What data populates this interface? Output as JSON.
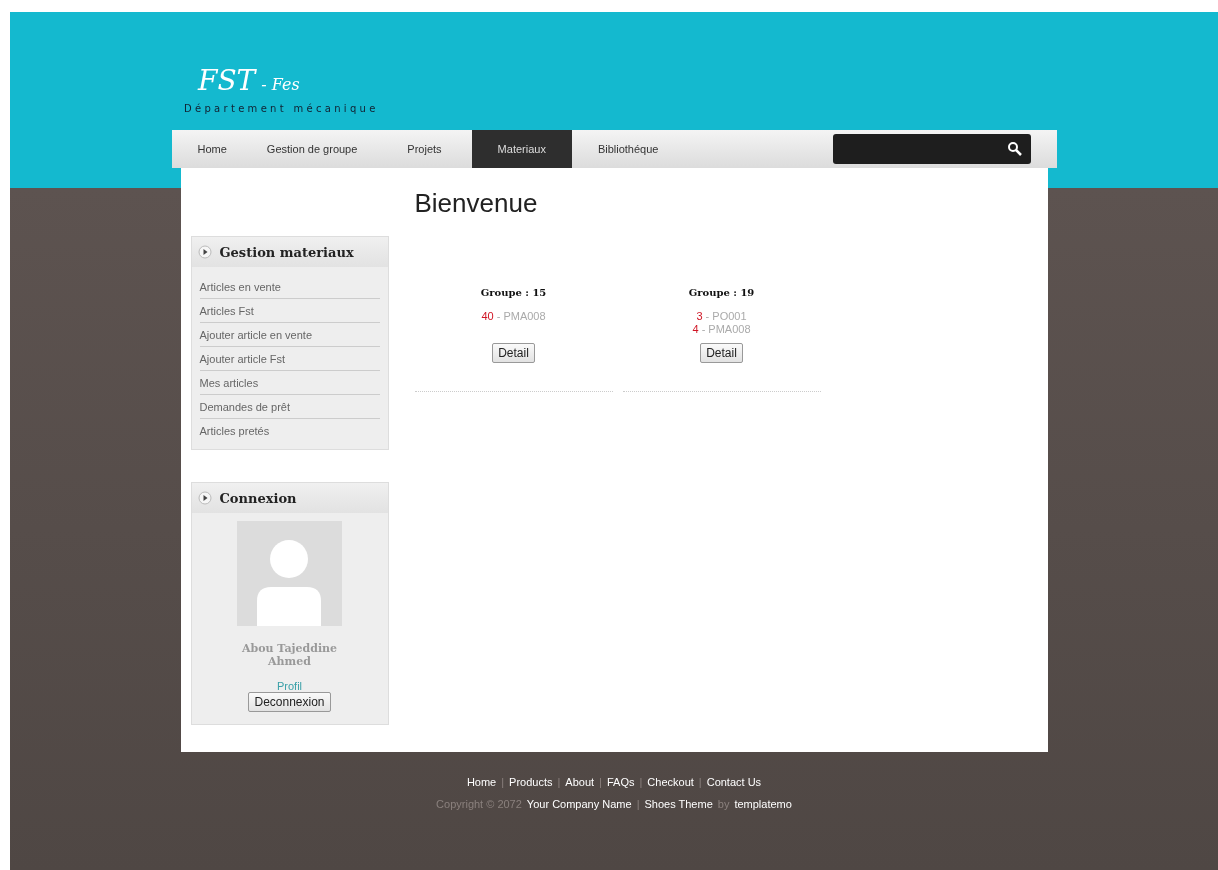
{
  "header": {
    "logo": "FST",
    "logo_suffix": "- Fes",
    "subtitle": "Département mécanique"
  },
  "nav": [
    {
      "label": "Home",
      "selected": false
    },
    {
      "label": "Gestion de groupe",
      "selected": false
    },
    {
      "label": "Projets",
      "selected": false
    },
    {
      "label": "Materiaux",
      "selected": true
    },
    {
      "label": "Bibliothéque",
      "selected": false
    }
  ],
  "sidebar": {
    "menu": {
      "title": "Gestion materiaux",
      "items": [
        "Articles en vente",
        "Articles Fst",
        "Ajouter article en vente",
        "Ajouter article Fst",
        "Mes articles",
        "Demandes de prêt",
        "Articles pretés"
      ]
    },
    "login": {
      "title": "Connexion",
      "name": "Abou Tajeddine Ahmed",
      "profile_link": "Profil",
      "logout": "Deconnexion"
    }
  },
  "main": {
    "title": "Bienvenue",
    "groups": [
      {
        "title": "Groupe : 15",
        "items": [
          {
            "qty": "40",
            "code": "- PMA008"
          }
        ],
        "button": "Detail"
      },
      {
        "title": "Groupe : 19",
        "items": [
          {
            "qty": "3",
            "code": "- PO001"
          },
          {
            "qty": "4",
            "code": "- PMA008"
          }
        ],
        "button": "Detail"
      }
    ]
  },
  "footer": {
    "separator": "|",
    "links": [
      "Home",
      "Products",
      "About",
      "FAQs",
      "Checkout",
      "Contact Us"
    ],
    "credits": [
      {
        "kind": "text",
        "text": "Copyright © 2072"
      },
      {
        "kind": "link",
        "text": "Your Company Name"
      },
      {
        "kind": "sep",
        "text": "|"
      },
      {
        "kind": "link",
        "text": "Shoes Theme"
      },
      {
        "kind": "text",
        "text": "by"
      },
      {
        "kind": "link",
        "text": "templatemo"
      }
    ]
  }
}
